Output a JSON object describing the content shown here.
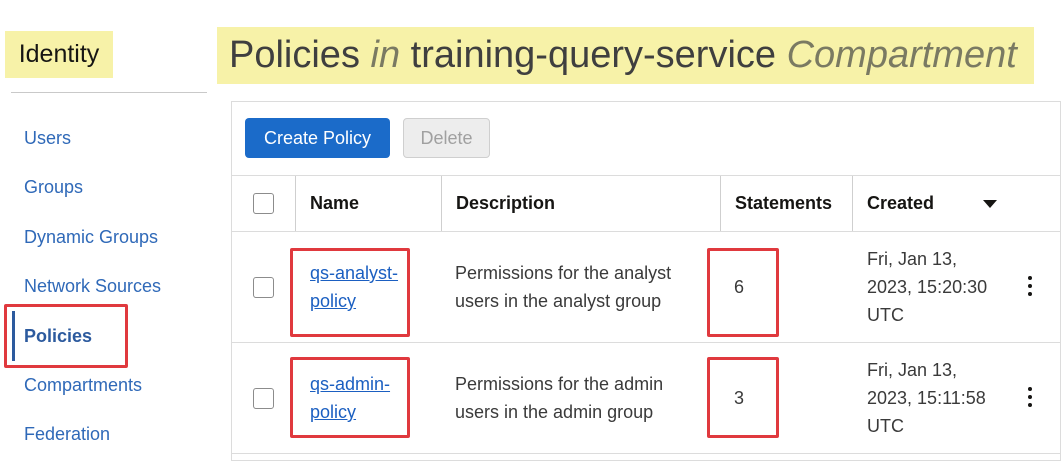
{
  "sidebar": {
    "section_title": "Identity",
    "items": [
      {
        "label": "Users"
      },
      {
        "label": "Groups"
      },
      {
        "label": "Dynamic Groups"
      },
      {
        "label": "Network Sources"
      },
      {
        "label": "Policies",
        "active": true
      },
      {
        "label": "Compartments"
      },
      {
        "label": "Federation"
      }
    ]
  },
  "page_title": {
    "part1": "Policies",
    "part2": "in",
    "part3": "training-query-service",
    "part4": "Compartment"
  },
  "toolbar": {
    "create_label": "Create Policy",
    "delete_label": "Delete"
  },
  "table": {
    "columns": [
      "Name",
      "Description",
      "Statements",
      "Created"
    ],
    "sort_indicator": "caret-down-icon",
    "rows": [
      {
        "name_line1": "qs-analyst-",
        "name_line2": "policy",
        "desc_line1": "Permissions for the analyst",
        "desc_line2": "users in the analyst group",
        "statements": "6",
        "created_line1": "Fri, Jan 13,",
        "created_line2": "2023, 15:20:30",
        "created_line3": "UTC"
      },
      {
        "name_line1": "qs-admin-",
        "name_line2": "policy",
        "desc_line1": "Permissions for the admin",
        "desc_line2": "users in the admin group",
        "statements": "3",
        "created_line1": "Fri, Jan 13,",
        "created_line2": "2023, 15:11:58",
        "created_line3": "UTC"
      }
    ]
  },
  "colors": {
    "highlight_yellow": "#f7f2a8",
    "annotation_red": "#e0393e",
    "primary_button": "#1b6bc9",
    "link": "#1b5fc1"
  }
}
